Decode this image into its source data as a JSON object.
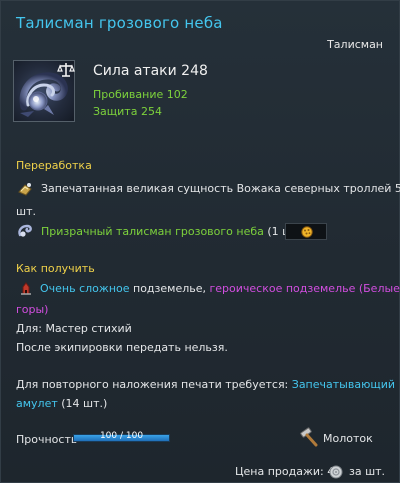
{
  "item": {
    "name": "Талисман грозового неба",
    "type": "Талисман",
    "icon": "storm-sky-talisman-icon",
    "attack_label": "Сила атаки 248",
    "stats": [
      "Пробивание 102",
      "Защита 254"
    ]
  },
  "rework": {
    "heading": "Переработка",
    "materials": [
      {
        "icon": "sealed-essence-icon",
        "text": "Запечатанная великая сущность Вожака северных троллей 5",
        "text_cont": "шт."
      },
      {
        "icon": "phantom-talisman-icon",
        "name": "Призрачный талисман грозового неба",
        "qty": "(1 шт.)",
        "slot_icon": "honeycomb-icon"
      }
    ]
  },
  "obtain": {
    "heading": "Как получить",
    "icon": "dungeon-icon",
    "hard_mode": "Очень сложное",
    "dungeon_word": " подземелье, ",
    "heroic": "героическое подземелье (Белые",
    "heroic_cont": "горы)"
  },
  "restrictions": {
    "class_line": "Для: Мастер стихий",
    "bind_line": "После экипировки передать нельзя."
  },
  "reseal": {
    "prefix": "Для повторного наложения печати требуется: ",
    "item": "Запечатывающий",
    "item_cont": "амулет",
    "qty": " (14 шт.)"
  },
  "durability": {
    "label": "Прочность",
    "value_text": "100 / 100",
    "fill_fraction": 1.0,
    "bar_color": "#2f8fd8"
  },
  "repair": {
    "icon": "hammer-icon",
    "label": "Молоток"
  },
  "sell": {
    "label": "Цена продажи: 4",
    "currency_icon": "silver-coin-icon",
    "unit": "за шт."
  },
  "colors": {
    "title": "#44c6ee",
    "section": "#f0d24a",
    "stat": "#7dd23c",
    "heroic": "#d24ee0"
  }
}
